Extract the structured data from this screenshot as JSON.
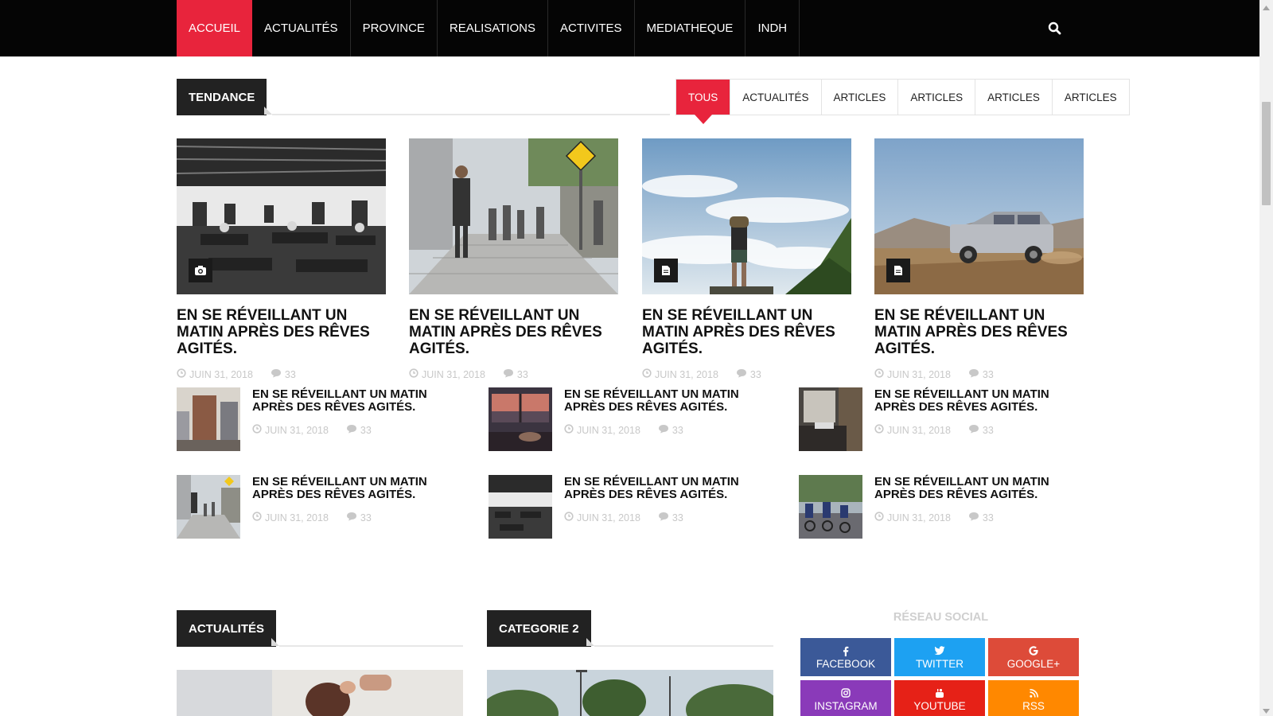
{
  "nav": {
    "items": [
      "ACCUEIL",
      "ACTUALITÉS",
      "PROVINCE",
      "REALISATIONS",
      "ACTIVITES",
      "MEDIATHEQUE",
      "INDH"
    ],
    "active_index": 0
  },
  "trending": {
    "title": "TENDANCE",
    "tabs": [
      "TOUS",
      "ACTUALITÉS",
      "ARTICLES",
      "ARTICLES",
      "ARTICLES",
      "ARTICLES"
    ],
    "active_tab": 0,
    "featured": [
      {
        "title": "EN SE RÉVEILLANT UN MATIN APRÈS DES RÊVES AGITÉS.",
        "date": "JUIN 31, 2018",
        "comments": "33",
        "badge": "camera-icon",
        "scene": "office"
      },
      {
        "title": "EN SE RÉVEILLANT UN MATIN APRÈS DES RÊVES AGITÉS.",
        "date": "JUIN 31, 2018",
        "comments": "33",
        "badge": "",
        "scene": "street"
      },
      {
        "title": "EN SE RÉVEILLANT UN MATIN APRÈS DES RÊVES AGITÉS.",
        "date": "JUIN 31, 2018",
        "comments": "33",
        "badge": "document-icon",
        "scene": "mountain"
      },
      {
        "title": "EN SE RÉVEILLANT UN MATIN APRÈS DES RÊVES AGITÉS.",
        "date": "JUIN 31, 2018",
        "comments": "33",
        "badge": "document-icon",
        "scene": "desert"
      }
    ],
    "small": [
      {
        "title": "EN SE RÉVEILLANT UN MATIN APRÈS DES RÊVES AGITÉS.",
        "date": "JUIN 31, 2018",
        "comments": "33",
        "scene": "city"
      },
      {
        "title": "EN SE RÉVEILLANT UN MATIN APRÈS DES RÊVES AGITÉS.",
        "date": "JUIN 31, 2018",
        "comments": "33",
        "scene": "sunset"
      },
      {
        "title": "EN SE RÉVEILLANT UN MATIN APRÈS DES RÊVES AGITÉS.",
        "date": "JUIN 31, 2018",
        "comments": "33",
        "scene": "room"
      },
      {
        "title": "EN SE RÉVEILLANT UN MATIN APRÈS DES RÊVES AGITÉS.",
        "date": "JUIN 31, 2018",
        "comments": "33",
        "scene": "street"
      },
      {
        "title": "EN SE RÉVEILLANT UN MATIN APRÈS DES RÊVES AGITÉS.",
        "date": "JUIN 31, 2018",
        "comments": "33",
        "scene": "office"
      },
      {
        "title": "EN SE RÉVEILLANT UN MATIN APRÈS DES RÊVES AGITÉS.",
        "date": "JUIN 31, 2018",
        "comments": "33",
        "scene": "cycling"
      }
    ]
  },
  "sections": {
    "news_title": "ACTUALITÉS",
    "category2_title": "CATEGORIE 2"
  },
  "social": {
    "title": "RÉSEAU SOCIAL",
    "buttons": [
      {
        "label": "FACEBOOK",
        "color": "#3b5998",
        "icon": "facebook-icon"
      },
      {
        "label": "TWITTER",
        "color": "#1da1f2",
        "icon": "twitter-icon"
      },
      {
        "label": "GOOGLE+",
        "color": "#dd4b39",
        "icon": "google-icon"
      },
      {
        "label": "INSTAGRAM",
        "color": "#8a3ab9",
        "icon": "instagram-icon"
      },
      {
        "label": "YOUTUBE",
        "color": "#e62117",
        "icon": "youtube-icon"
      },
      {
        "label": "RSS",
        "color": "#ff8800",
        "icon": "rss-icon"
      }
    ]
  },
  "colors": {
    "accent": "#e8243c",
    "nav_bg": "#050505",
    "tag_bg": "#222222"
  }
}
